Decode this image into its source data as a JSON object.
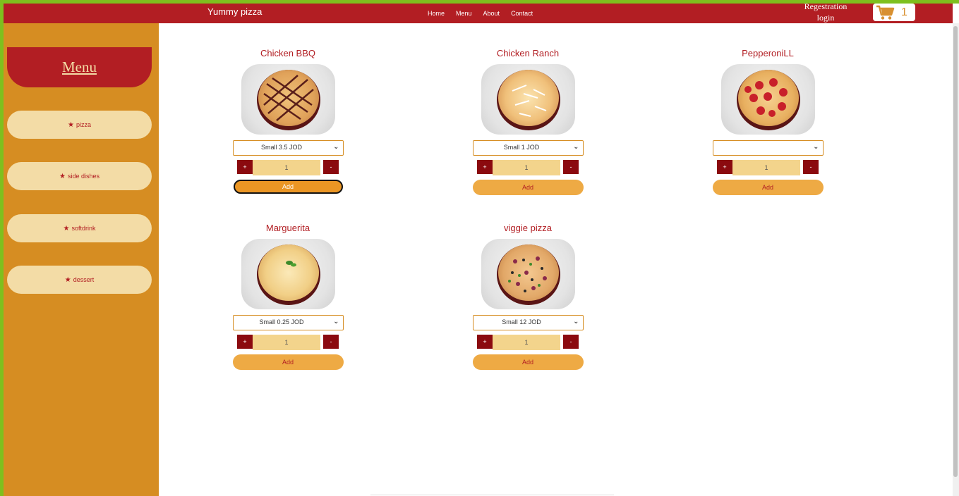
{
  "navbar": {
    "brand": "Yummy pizza",
    "links": [
      "Home",
      "Menu",
      "About",
      "Contact"
    ],
    "account_line1": "Regestration",
    "account_line2": "login",
    "cart_icon": "cart-icon",
    "cart_count": "1"
  },
  "sidebar": {
    "title": "Menu",
    "star": "★",
    "items": [
      "pizza",
      "side dishes",
      "softdrink",
      "dessert"
    ]
  },
  "products": [
    {
      "name": "Chicken BBQ",
      "size": "Small 3.5 JOD",
      "qty": "1",
      "plus": "+",
      "minus": "-",
      "add": "Add"
    },
    {
      "name": "Chicken Ranch",
      "size": "Small 1 JOD",
      "qty": "1",
      "plus": "+",
      "minus": "-",
      "add": "Add"
    },
    {
      "name": "PepperoniLL",
      "size": "",
      "qty": "1",
      "plus": "+",
      "minus": "-",
      "add": "Add"
    },
    {
      "name": "Marguerita",
      "size": "Small 0.25 JOD",
      "qty": "1",
      "plus": "+",
      "minus": "-",
      "add": "Add"
    },
    {
      "name": "viggie pizza",
      "size": "Small 12 JOD",
      "qty": "1",
      "plus": "+",
      "minus": "-",
      "add": "Add"
    }
  ],
  "colors": {
    "brand_red": "#b21e23",
    "sidebar_orange": "#d68d22",
    "cream": "#f3dca6",
    "button_orange": "#eeaa44"
  }
}
